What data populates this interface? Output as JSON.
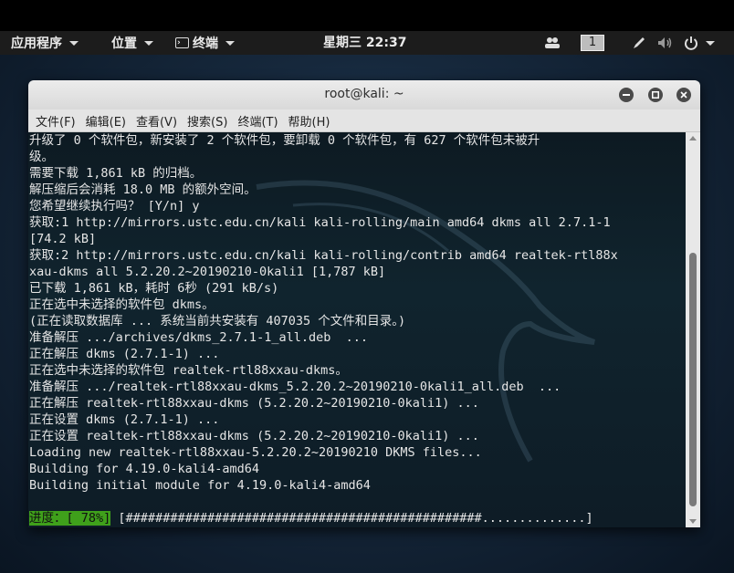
{
  "panel": {
    "applications": "应用程序",
    "places": "位置",
    "terminal_app": "终端",
    "clock": "星期三 22:37",
    "workspace": "1"
  },
  "window": {
    "title": "root@kali: ~",
    "menu": [
      "文件(F)",
      "编辑(E)",
      "查看(V)",
      "搜索(S)",
      "终端(T)",
      "帮助(H)"
    ]
  },
  "terminal": {
    "lines": [
      "升级了 0 个软件包，新安装了 2 个软件包，要卸载 0 个软件包，有 627 个软件包未被升",
      "级。",
      "需要下载 1,861 kB 的归档。",
      "解压缩后会消耗 18.0 MB 的额外空间。",
      "您希望继续执行吗？ [Y/n] y",
      "获取:1 http://mirrors.ustc.edu.cn/kali kali-rolling/main amd64 dkms all 2.7.1-1",
      "[74.2 kB]",
      "获取:2 http://mirrors.ustc.edu.cn/kali kali-rolling/contrib amd64 realtek-rtl88x",
      "xau-dkms all 5.2.20.2~20190210-0kali1 [1,787 kB]",
      "已下载 1,861 kB，耗时 6秒 (291 kB/s)",
      "正在选中未选择的软件包 dkms。",
      "(正在读取数据库 ... 系统当前共安装有 407035 个文件和目录。)",
      "准备解压 .../archives/dkms_2.7.1-1_all.deb  ...",
      "正在解压 dkms (2.7.1-1) ...",
      "正在选中未选择的软件包 realtek-rtl88xxau-dkms。",
      "准备解压 .../realtek-rtl88xxau-dkms_5.2.20.2~20190210-0kali1_all.deb  ...",
      "正在解压 realtek-rtl88xxau-dkms (5.2.20.2~20190210-0kali1) ...",
      "正在设置 dkms (2.7.1-1) ...",
      "正在设置 realtek-rtl88xxau-dkms (5.2.20.2~20190210-0kali1) ...",
      "Loading new realtek-rtl88xxau-5.2.20.2~20190210 DKMS files...",
      "Building for 4.19.0-kali4-amd64",
      "Building initial module for 4.19.0-kali4-amd64"
    ],
    "progress_label": "进度：[ 78%]",
    "progress_bar": "[################################################..............]",
    "progress_percent": 78
  },
  "colors": {
    "progress_badge": "#3fa01b"
  },
  "icons": [
    "terminal-icon",
    "people-icon",
    "pen-icon",
    "volume-icon",
    "power-icon",
    "minimize-icon",
    "maximize-icon",
    "close-icon"
  ]
}
